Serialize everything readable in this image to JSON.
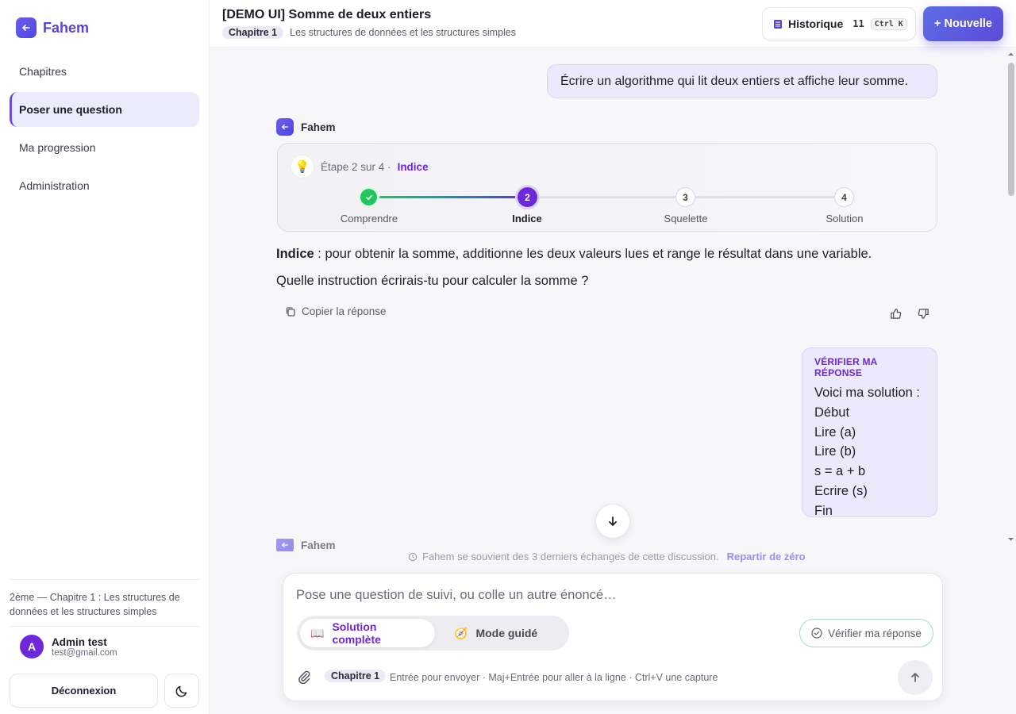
{
  "brand": {
    "name": "Fahem",
    "logo_icon": "arrow-left-icon"
  },
  "sidebar": {
    "items": [
      {
        "label": "Chapitres",
        "active": false
      },
      {
        "label": "Poser une question",
        "active": true
      },
      {
        "label": "Ma progression",
        "active": false
      },
      {
        "label": "Administration",
        "active": false
      }
    ],
    "context": "2ème — Chapitre 1 : Les structures de données et les structures simples",
    "user": {
      "initial": "A",
      "name": "Admin test",
      "email": "test@gmail.com"
    },
    "logout_label": "Déconnexion",
    "theme_icon": "moon-icon"
  },
  "header": {
    "title": "[DEMO UI] Somme de deux entiers",
    "chapter_chip": "Chapitre 1",
    "chapter_title": "Les structures de données et les structures simples",
    "history_label": "Historique",
    "history_count": "11",
    "history_shortcut": "Ctrl K",
    "new_label": "+ Nouvelle"
  },
  "chat": {
    "user_message": "Écrire un algorithme qui lit deux entiers et affiche leur somme.",
    "bot_name": "Fahem",
    "stepper": {
      "progress_text": "Étape 2 sur 4 ·",
      "kind": "Indice",
      "current": 2,
      "total": 4,
      "steps": [
        {
          "number": "1",
          "label": "Comprendre",
          "state": "done"
        },
        {
          "number": "2",
          "label": "Indice",
          "state": "current"
        },
        {
          "number": "3",
          "label": "Squelette",
          "state": "todo"
        },
        {
          "number": "4",
          "label": "Solution",
          "state": "todo"
        }
      ]
    },
    "answer_bold": "Indice",
    "answer_rest": " : pour obtenir la somme, additionne les deux valeurs lues et range le résultat dans une variable.",
    "answer_question": "Quelle instruction écrirais-tu pour calculer la somme ?",
    "copy_label": "Copier la réponse",
    "verify_tag": "VÉRIFIER MA RÉPONSE",
    "verify_lines": [
      "Voici ma solution :",
      "Début",
      "Lire (a)",
      "Lire (b)",
      "s = a + b",
      "Ecrire (s)",
      "Fin"
    ],
    "memory_note": "Fahem se souvient des 3 derniers échanges de cette discussion.",
    "memory_link": "Repartir de zéro"
  },
  "composer": {
    "placeholder": "Pose une question de suivi, ou colle un autre énoncé…",
    "modes": [
      {
        "label": "Solution complète",
        "icon": "book-icon",
        "active": true
      },
      {
        "label": "Mode guidé",
        "icon": "compass-icon",
        "active": false
      }
    ],
    "verify_label": "Vérifier ma réponse",
    "chip": "Chapitre 1",
    "hint": "Entrée pour envoyer · Maj+Entrée pour aller à la ligne · Ctrl+V une capture"
  },
  "colors": {
    "accent": "#6d28d9",
    "brand": "#5b3fd6",
    "success": "#22c55e"
  }
}
